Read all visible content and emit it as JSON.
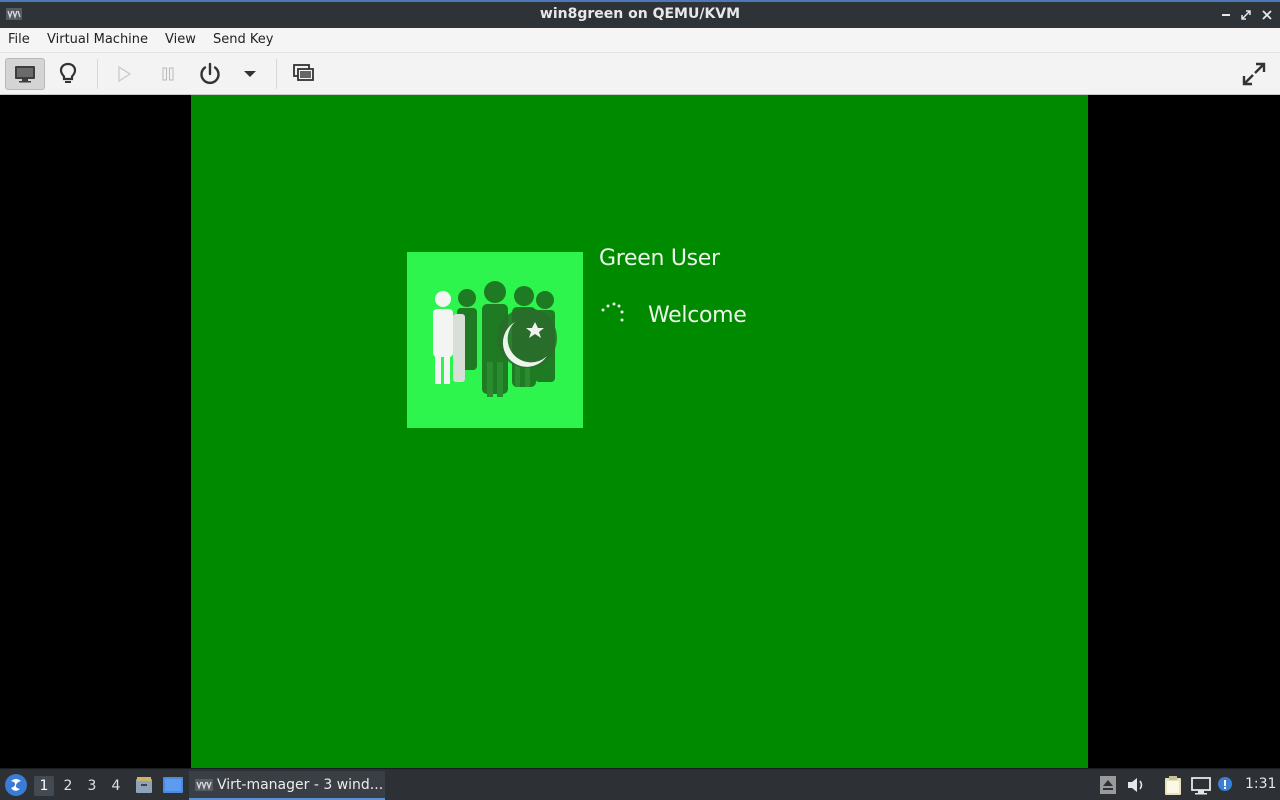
{
  "window": {
    "title": "win8green on QEMU/KVM",
    "controls": {
      "minimize": "‒",
      "maximize": "⤢",
      "close": "✕"
    }
  },
  "menubar": {
    "items": [
      {
        "label": "File"
      },
      {
        "label": "Virtual Machine"
      },
      {
        "label": "View"
      },
      {
        "label": "Send Key"
      }
    ]
  },
  "toolbar": {
    "buttons": [
      {
        "name": "console-icon",
        "state": "active"
      },
      {
        "name": "lightbulb-icon",
        "state": "normal"
      },
      {
        "name": "play-icon",
        "state": "disabled"
      },
      {
        "name": "pause-icon",
        "state": "disabled"
      },
      {
        "name": "power-icon",
        "state": "normal"
      },
      {
        "name": "dropdown-arrow-icon",
        "state": "normal"
      },
      {
        "name": "snapshots-icon",
        "state": "normal"
      },
      {
        "name": "fullscreen-icon",
        "state": "normal"
      }
    ]
  },
  "guest": {
    "background_color": "#008a00",
    "avatar_color": "#2ef54d",
    "user_name": "Green User",
    "status": "Welcome"
  },
  "taskbar": {
    "workspaces": [
      "1",
      "2",
      "3",
      "4"
    ],
    "active_workspace": "1",
    "task_label": "Virt-manager - 3 wind...",
    "clock": "1:31",
    "tray_icons": [
      "eject-icon",
      "volume-icon",
      "clipboard-icon",
      "network-icon",
      "notification-icon"
    ]
  },
  "colors": {
    "titlebar_bg": "#2e3338",
    "accent": "#4d7ab6"
  }
}
